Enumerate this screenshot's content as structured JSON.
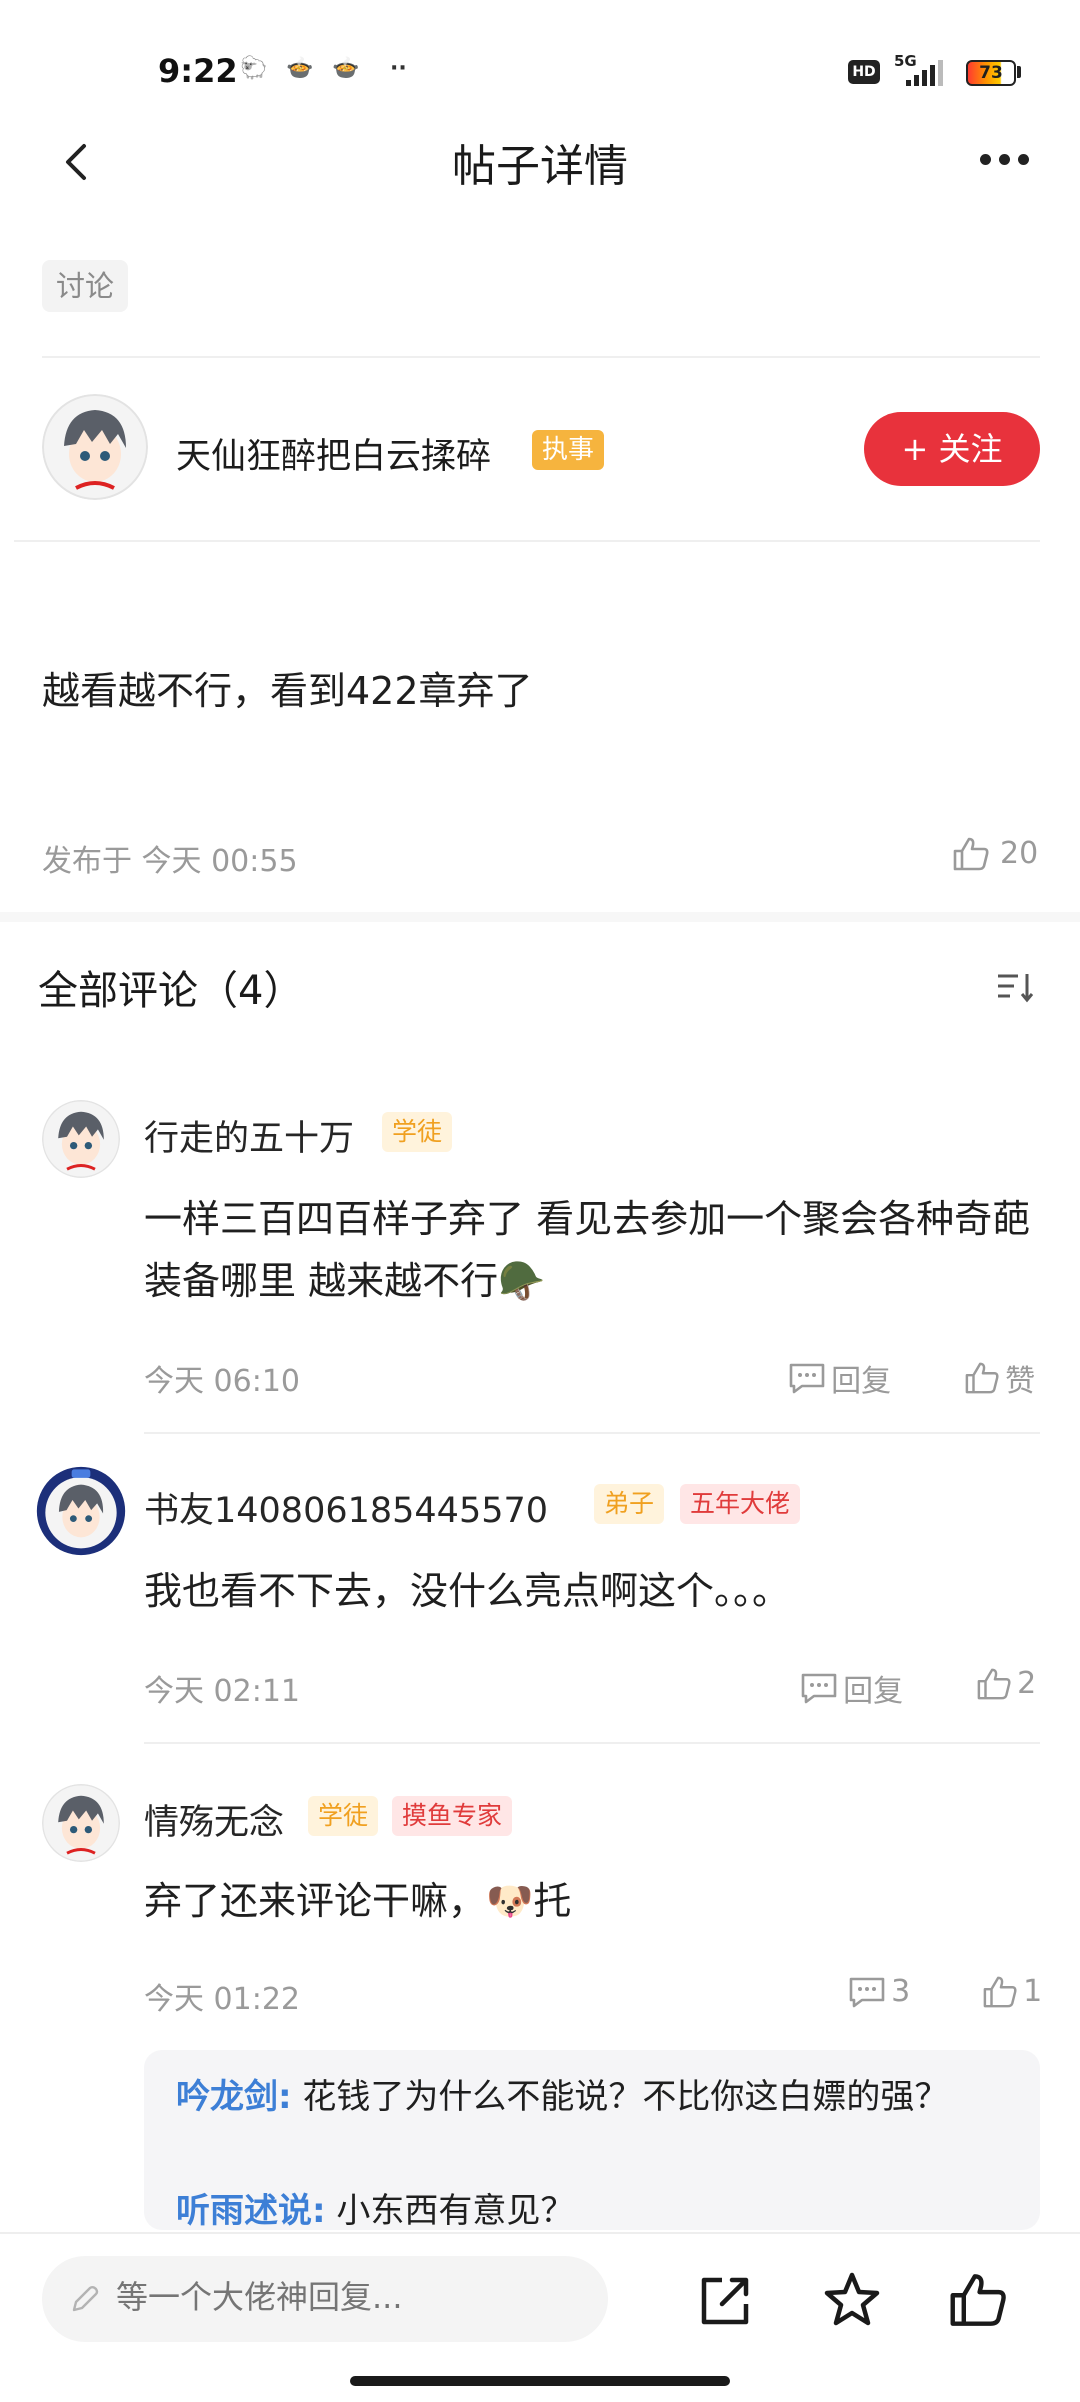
{
  "status_bar": {
    "time": "9:22",
    "network": "5G",
    "hd": "HD",
    "battery": "73"
  },
  "nav": {
    "title": "帖子详情"
  },
  "post": {
    "tag": "讨论",
    "author": {
      "name": "天仙狂醉把白云揉碎",
      "role_badge": "执事"
    },
    "follow_label": "+ 关注",
    "content": "越看越不行，看到422章弃了",
    "published": "发布于 今天 00:55",
    "likes": "20"
  },
  "comments_header": {
    "title": "全部评论（4）"
  },
  "comments": [
    {
      "name": "行走的五十万",
      "badges": [
        "学徒"
      ],
      "text": "一样三百四百样子弃了 看见去参加一个聚会各种奇葩装备哪里 越来越不行🪖",
      "time": "今天 06:10",
      "reply_label": "回复",
      "like_label": "赞"
    },
    {
      "name": "书友140806185445570",
      "badges": [
        "弟子",
        "五年大佬"
      ],
      "text": "我也看不下去，没什么亮点啊这个。。。",
      "time": "今天 02:11",
      "reply_label": "回复",
      "like_label": "2"
    },
    {
      "name": "情殇无念",
      "badges": [
        "学徒",
        "摸鱼专家"
      ],
      "text": "弃了还来评论干嘛，🐶托",
      "time": "今天 01:22",
      "reply_label": "3",
      "like_label": "1",
      "replies": [
        {
          "name": "吟龙剑:",
          "text": "花钱了为什么不能说？不比你这白嫖的强？"
        },
        {
          "name": "听雨述说:",
          "text": "小东西有意见？"
        }
      ]
    }
  ],
  "bottom_bar": {
    "placeholder": "等一个大佬神回复..."
  }
}
